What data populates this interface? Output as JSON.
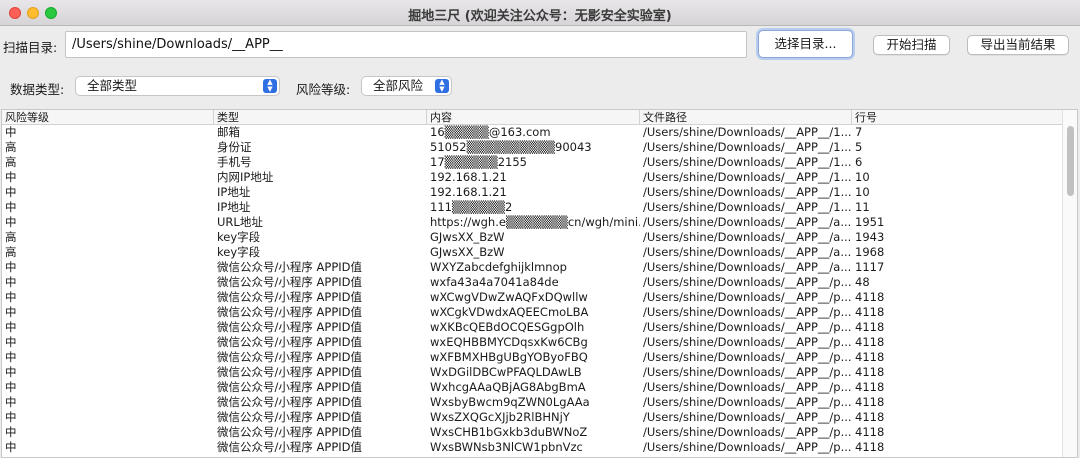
{
  "window": {
    "title": "掘地三尺 (欢迎关注公众号：无影安全实验室)"
  },
  "scan": {
    "label": "扫描目录:",
    "path": "/Users/shine/Downloads/__APP__",
    "choose_dir_label": "选择目录...",
    "start_label": "开始扫描",
    "export_label": "导出当前结果"
  },
  "filters": {
    "data_type_label": "数据类型:",
    "data_type_value": "全部类型",
    "risk_label": "风险等级:",
    "risk_value": "全部风险"
  },
  "table": {
    "columns": [
      "风险等级",
      "类型",
      "内容",
      "文件路径",
      "行号"
    ],
    "rows": [
      [
        "中",
        "邮箱",
        "16▒▒▒▒▒@163.com",
        "/Users/shine/Downloads/__APP__/1...",
        "7"
      ],
      [
        "高",
        "身份证",
        "51052▒▒▒▒▒▒▒▒▒▒90043",
        "/Users/shine/Downloads/__APP__/1...",
        "5"
      ],
      [
        "高",
        "手机号",
        "17▒▒▒▒▒▒2155",
        "/Users/shine/Downloads/__APP__/1...",
        "6"
      ],
      [
        "中",
        "内网IP地址",
        "192.168.1.21",
        "/Users/shine/Downloads/__APP__/1...",
        "10"
      ],
      [
        "中",
        "IP地址",
        "192.168.1.21",
        "/Users/shine/Downloads/__APP__/1...",
        "10"
      ],
      [
        "中",
        "IP地址",
        "111▒▒▒▒▒▒2",
        "/Users/shine/Downloads/__APP__/1...",
        "11"
      ],
      [
        "中",
        "URL地址",
        "https://wgh.e▒▒▒▒▒▒▒cn/wgh/mini...",
        "/Users/shine/Downloads/__APP__/a...",
        "1951"
      ],
      [
        "高",
        "key字段",
        "GJwsXX_BzW",
        "/Users/shine/Downloads/__APP__/a...",
        "1943"
      ],
      [
        "高",
        "key字段",
        "GJwsXX_BzW",
        "/Users/shine/Downloads/__APP__/a...",
        "1968"
      ],
      [
        "中",
        "微信公众号/小程序 APPID值",
        "WXYZabcdefghijklmnop",
        "/Users/shine/Downloads/__APP__/a...",
        "1117"
      ],
      [
        "中",
        "微信公众号/小程序 APPID值",
        "wxfa43a4a7041a84de",
        "/Users/shine/Downloads/__APP__/p...",
        "48"
      ],
      [
        "中",
        "微信公众号/小程序 APPID值",
        "wXCwgVDwZwAQFxDQwllw",
        "/Users/shine/Downloads/__APP__/p...",
        "4118"
      ],
      [
        "中",
        "微信公众号/小程序 APPID值",
        "wXCgkVDwdxAQEECmoLBA",
        "/Users/shine/Downloads/__APP__/p...",
        "4118"
      ],
      [
        "中",
        "微信公众号/小程序 APPID值",
        "wXKBcQEBdOCQESGgpOlh",
        "/Users/shine/Downloads/__APP__/p...",
        "4118"
      ],
      [
        "中",
        "微信公众号/小程序 APPID值",
        "wxEQHBBMYCDqsxKw6CBg",
        "/Users/shine/Downloads/__APP__/p...",
        "4118"
      ],
      [
        "中",
        "微信公众号/小程序 APPID值",
        "wXFBMXHBgUBgYOByoFBQ",
        "/Users/shine/Downloads/__APP__/p...",
        "4118"
      ],
      [
        "中",
        "微信公众号/小程序 APPID值",
        "WxDGilDBCwPFAQLDAwLB",
        "/Users/shine/Downloads/__APP__/p...",
        "4118"
      ],
      [
        "中",
        "微信公众号/小程序 APPID值",
        "WxhcgAAaQBjAG8AbgBmA",
        "/Users/shine/Downloads/__APP__/p...",
        "4118"
      ],
      [
        "中",
        "微信公众号/小程序 APPID值",
        "WxsbyBwcm9qZWN0LgAAa",
        "/Users/shine/Downloads/__APP__/p...",
        "4118"
      ],
      [
        "中",
        "微信公众号/小程序 APPID值",
        "WxsZXQGcXJjb2RlBHNjY",
        "/Users/shine/Downloads/__APP__/p...",
        "4118"
      ],
      [
        "中",
        "微信公众号/小程序 APPID值",
        "WxsCHB1bGxkb3duBWNoZ",
        "/Users/shine/Downloads/__APP__/p...",
        "4118"
      ],
      [
        "中",
        "微信公众号/小程序 APPID值",
        "WxsBWNsb3NlCW1pbnVzc",
        "/Users/shine/Downloads/__APP__/p...",
        "4118"
      ]
    ]
  },
  "colors": {
    "accent": "#2f6fe4",
    "focus_ring": "#b7cdf0",
    "close": "#fe5f57",
    "minimize": "#febc2e",
    "maximize": "#28c840"
  }
}
